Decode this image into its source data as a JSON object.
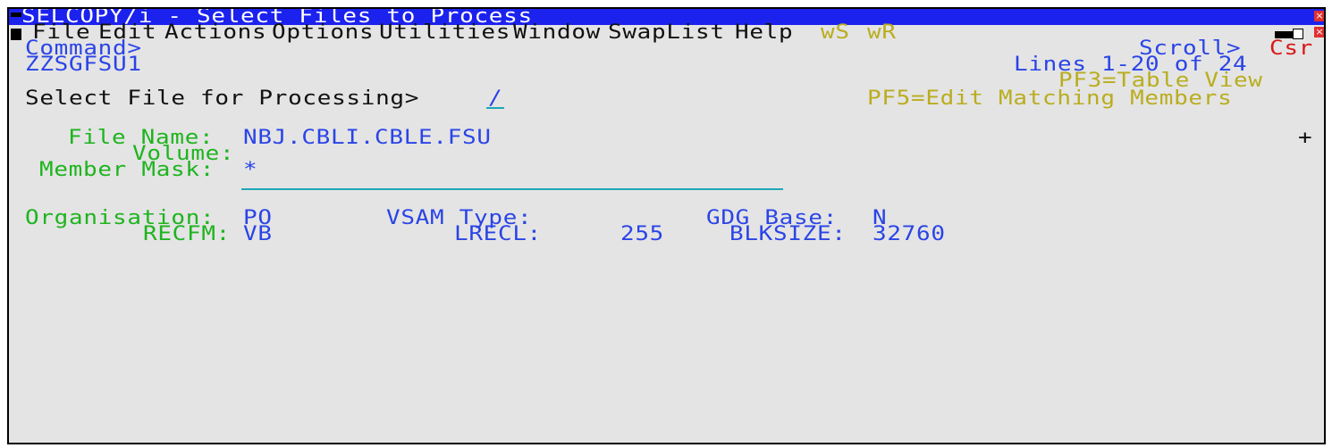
{
  "window": {
    "title": "SELCOPY/i - Select Files to Process",
    "close_glyph": "×"
  },
  "menubar": {
    "items": [
      "File",
      "Edit",
      "Actions",
      "Options",
      "Utilities",
      "Window",
      "SwapList",
      "Help"
    ],
    "ws": "wS",
    "wr": "wR"
  },
  "command": {
    "label": "Command>",
    "value": "",
    "scroll_label": "Scroll>",
    "scroll_value": "Csr"
  },
  "panel": {
    "id": "ZZSGFSU1",
    "lines": "Lines 1-20 of 24",
    "pf3": "PF3=Table View",
    "pf5": "PF5=Edit Matching Members",
    "select_label": "Select File for Processing>",
    "select_value": "/"
  },
  "file": {
    "file_name_label": "File Name:",
    "file_name_value": "NBJ.CBLI.CBLE.FSU",
    "plus": "+",
    "volume_label": "Volume:",
    "volume_value": "",
    "member_mask_label": "Member Mask:",
    "member_mask_value": "*"
  },
  "attributes": {
    "organisation_label": "Organisation:",
    "organisation_value": "PO",
    "vsam_type_label": "VSAM Type:",
    "vsam_type_value": "",
    "gdg_base_label": "GDG Base:",
    "gdg_base_value": "N",
    "recfm_label": "RECFM:",
    "recfm_value": "VB",
    "lrecl_label": "LRECL:",
    "lrecl_value": "255",
    "blksize_label": "BLKSIZE:",
    "blksize_value": "32760"
  }
}
